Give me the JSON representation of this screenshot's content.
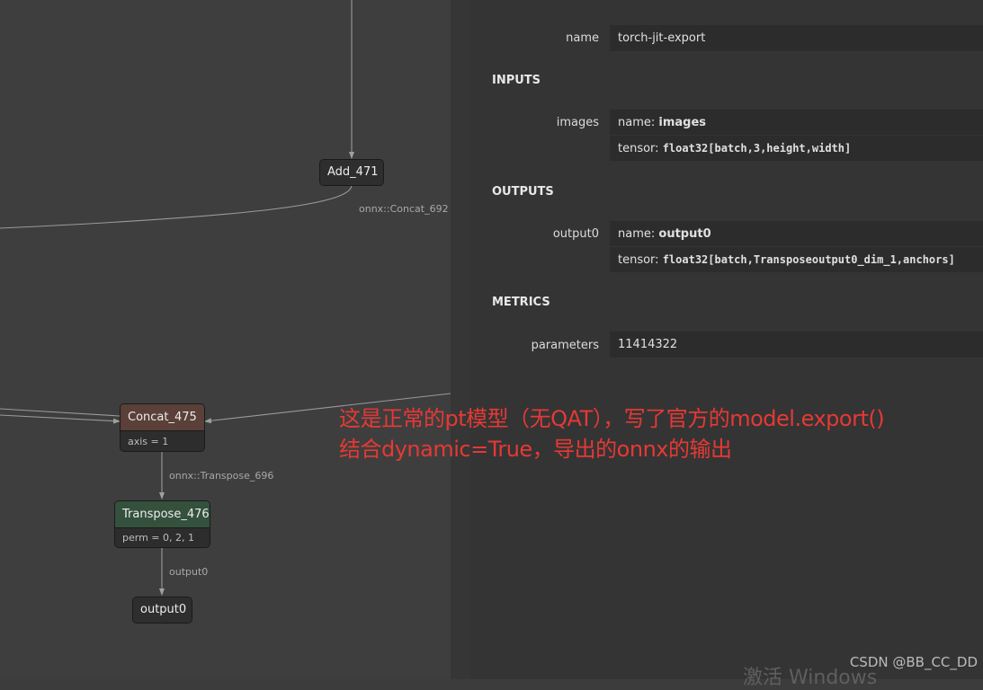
{
  "graph": {
    "nodes": {
      "add": {
        "label": "Add_471"
      },
      "concat": {
        "label": "Concat_475",
        "attr": "axis = 1"
      },
      "transpose": {
        "label": "Transpose_476",
        "attr": "perm = 0, 2, 1"
      },
      "output": {
        "label": "output0"
      }
    },
    "edge_labels": {
      "add_out": "onnx::Concat_692",
      "concat_out": "onnx::Transpose_696",
      "transpose_out": "output0"
    },
    "colors": {
      "add_header": "#2e2e2e",
      "concat_header": "#5a4038",
      "transpose_header": "#34513d",
      "output_header": "#2e2e2e"
    }
  },
  "sidebar": {
    "name_label": "name",
    "name_value": "torch-jit-export",
    "inputs_heading": "INPUTS",
    "inputs": {
      "label": "images",
      "name_prefix": "name: ",
      "name_value": "images",
      "tensor_prefix": "tensor: ",
      "tensor_value": "float32[batch,3,height,width]"
    },
    "outputs_heading": "OUTPUTS",
    "outputs": {
      "label": "output0",
      "name_prefix": "name: ",
      "name_value": "output0",
      "tensor_prefix": "tensor: ",
      "tensor_value": "float32[batch,Transposeoutput0_dim_1,anchors]"
    },
    "metrics_heading": "METRICS",
    "metrics": {
      "label": "parameters",
      "value": "11414322"
    }
  },
  "annotation": {
    "line1": "这是正常的pt模型（无QAT），写了官方的model.export()",
    "line2": "结合dynamic=True，导出的onnx的输出",
    "color": "#e53935"
  },
  "watermark": "CSDN @BB_CC_DD",
  "windows_activation": "激活 Windows"
}
